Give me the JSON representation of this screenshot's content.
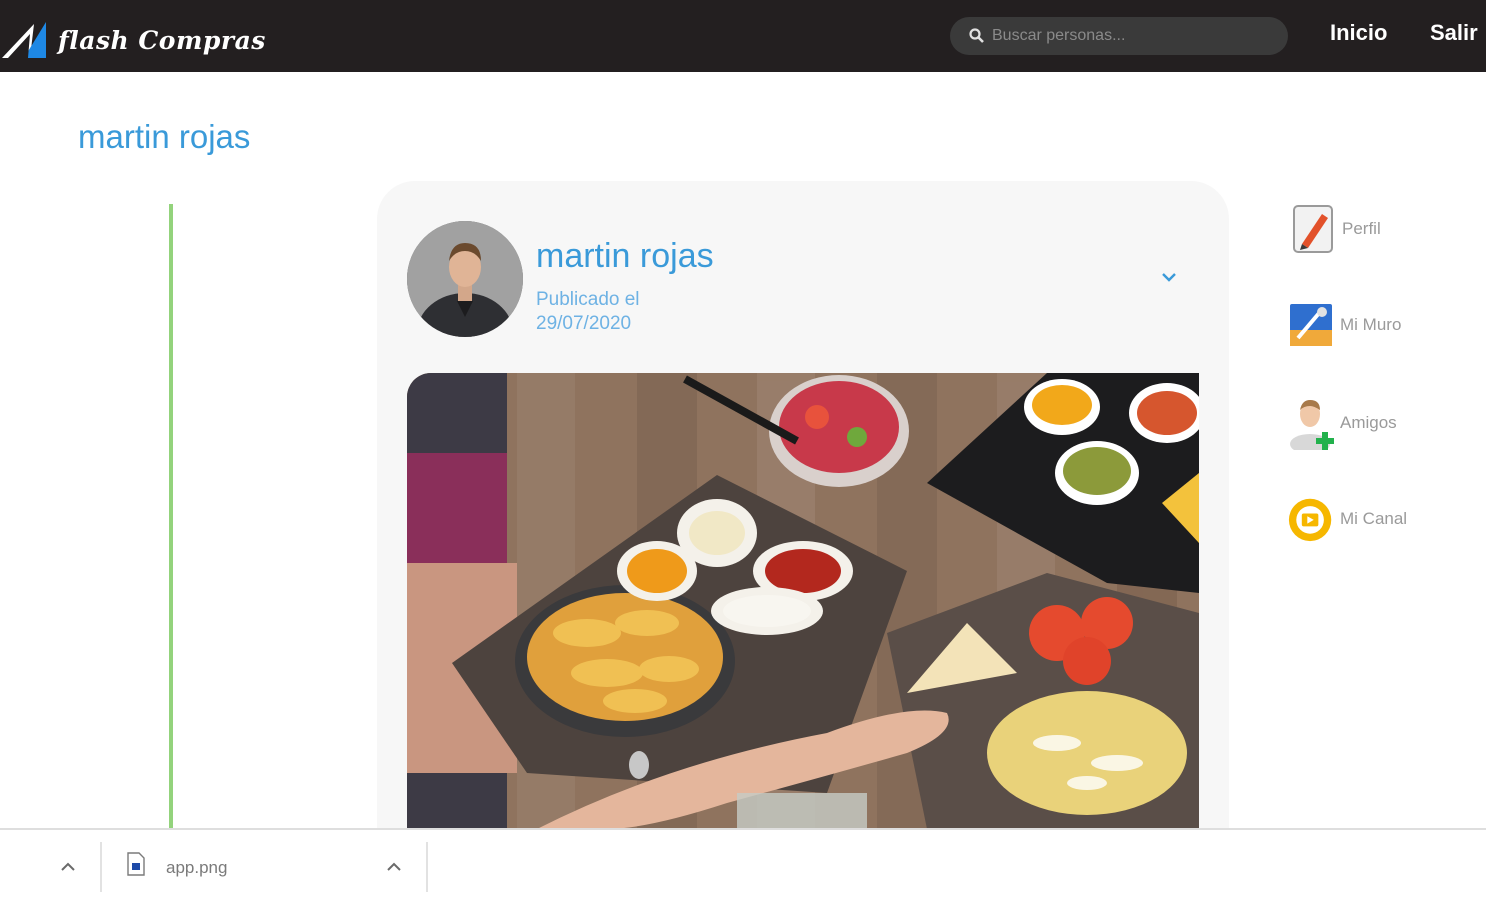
{
  "header": {
    "brand": "flash Compras",
    "search_placeholder": "Buscar personas...",
    "nav": {
      "home": "Inicio",
      "logout": "Salir"
    }
  },
  "profile": {
    "name": "martin rojas"
  },
  "post": {
    "author": "martin rojas",
    "date_label": "Publicado el",
    "date": "29/07/2020"
  },
  "sidebar": {
    "items": [
      {
        "label": "Perfil",
        "icon": "edit-profile-icon"
      },
      {
        "label": "Mi Muro",
        "icon": "wall-icon"
      },
      {
        "label": "Amigos",
        "icon": "add-friend-icon"
      },
      {
        "label": "Mi Canal",
        "icon": "play-channel-icon"
      }
    ]
  },
  "downloads": {
    "file_name": "app.png"
  },
  "colors": {
    "nav_bg": "#231f20",
    "accent_blue": "#3a9ad9",
    "line_green": "#93d37c",
    "card_bg": "#f7f7f7",
    "channel_yellow": "#f6b700"
  }
}
